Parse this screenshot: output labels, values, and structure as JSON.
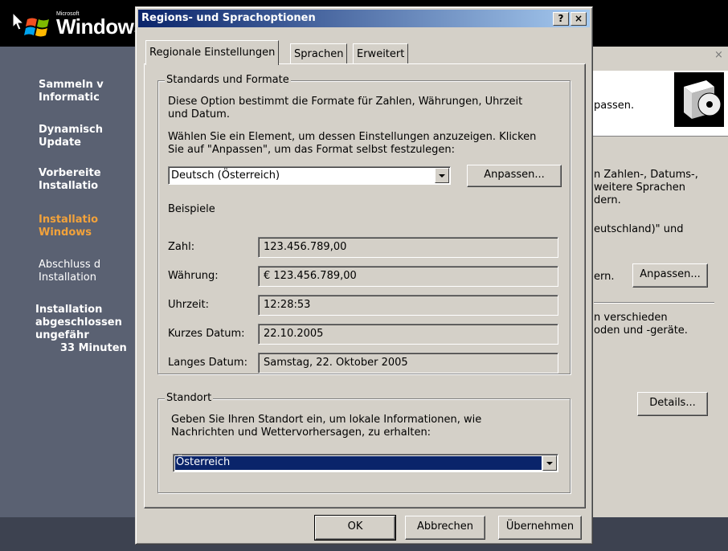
{
  "setup": {
    "brand_small": "Microsoft",
    "brand": "Windows",
    "steps": [
      {
        "label_1": "Sammeln v",
        "label_2": "Informatic"
      },
      {
        "label_1": "Dynamisch",
        "label_2": "Update"
      },
      {
        "label_1": "Vorbereite",
        "label_2": "Installatio"
      },
      {
        "label_1": "Installatio",
        "label_2": "Windows"
      },
      {
        "label_1": "Abschluss d",
        "label_2": "Installation"
      }
    ],
    "time_1": "Installation",
    "time_2": "abgeschlossen",
    "time_3": "ungefähr",
    "time_4": "33 Minuten"
  },
  "background_window": {
    "close": "×",
    "header_text": "passen.",
    "text_1a": "n Zahlen-, Datums-,",
    "text_1b": "weitere Sprachen",
    "text_1c": "dern.",
    "text_2": "eutschland)\" und",
    "text_3": "ern.",
    "customize_button": "Anpassen...",
    "text_4a": "n verschieden",
    "text_4b": "oden und -geräte.",
    "details_button": "Details..."
  },
  "dialog": {
    "title": "Regions- und Sprachoptionen",
    "help_button": "?",
    "close_button": "×",
    "tabs": [
      {
        "label": "Regionale Einstellungen"
      },
      {
        "label": "Sprachen"
      },
      {
        "label": "Erweitert"
      }
    ],
    "formats": {
      "legend": "Standards und Formate",
      "desc_1": "Diese Option bestimmt die Formate für Zahlen, Währungen, Uhrzeit",
      "desc_2": "und Datum.",
      "select_1": "Wählen Sie ein Element, um dessen Einstellungen anzuzeigen. Klicken",
      "select_2": "Sie auf \"Anpassen\", um das Format selbst festzulegen:",
      "selected_format": "Deutsch (Österreich)",
      "customize_button": "Anpassen...",
      "examples_heading": "Beispiele",
      "examples": [
        {
          "label": "Zahl:",
          "value": "123.456.789,00"
        },
        {
          "label": "Währung:",
          "value": "€ 123.456.789,00"
        },
        {
          "label": "Uhrzeit:",
          "value": "12:28:53"
        },
        {
          "label": "Kurzes Datum:",
          "value": "22.10.2005"
        },
        {
          "label": "Langes Datum:",
          "value": "Samstag, 22. Oktober 2005"
        }
      ]
    },
    "location": {
      "legend": "Standort",
      "desc_1": "Geben Sie Ihren Standort ein, um lokale Informationen, wie",
      "desc_2": "Nachrichten und Wettervorhersagen, zu erhalten:",
      "selected_location": "Österreich"
    },
    "buttons": {
      "ok": "OK",
      "cancel": "Abbrechen",
      "apply": "Übernehmen"
    }
  }
}
